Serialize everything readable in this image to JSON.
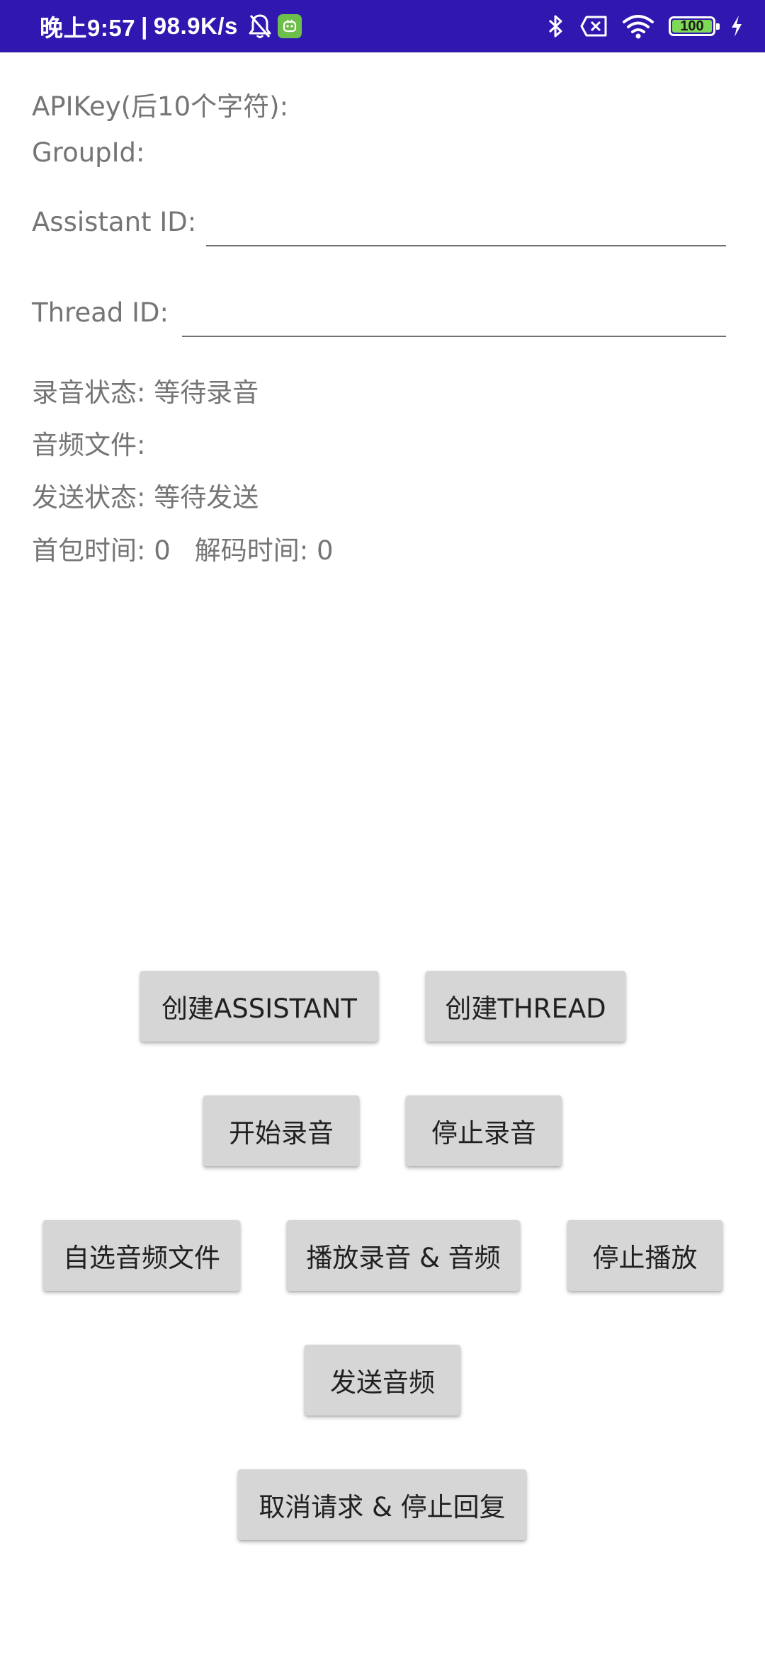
{
  "status_bar": {
    "time": "晚上9:57",
    "separator": "|",
    "net_speed": "98.9K/s",
    "battery_level": "100",
    "icons": [
      "bell-muted-icon",
      "app-notification-icon",
      "bluetooth-icon",
      "sim-off-icon",
      "wifi-icon",
      "battery-icon",
      "charging-bolt-icon"
    ],
    "colors": {
      "background": "#3017b0",
      "text": "#ffffff",
      "battery_fill": "#7ed957"
    }
  },
  "info": {
    "apikey_label": "APIKey(后10个字符):",
    "groupid_label": "GroupId:",
    "assistant_id_label": "Assistant ID:",
    "assistant_id_value": "",
    "thread_id_label": "Thread ID:",
    "thread_id_value": "",
    "record_status": "录音状态: 等待录音",
    "audio_file": "音频文件:",
    "send_status": "发送状态: 等待发送",
    "first_packet_time": "首包时间: 0",
    "decode_time": "解码时间: 0"
  },
  "buttons": {
    "create_assistant": "创建ASSISTANT",
    "create_thread": "创建THREAD",
    "start_recording": "开始录音",
    "stop_recording": "停止录音",
    "choose_audio_file": "自选音频文件",
    "play_recording_audio": "播放录音 & 音频",
    "stop_playback": "停止播放",
    "send_audio": "发送音频",
    "cancel_request_stop_reply": "取消请求 & 停止回复"
  },
  "colors": {
    "button_background": "#d6d6d6",
    "button_text": "#202020",
    "label_text": "#757575",
    "field_underline": "#707070"
  }
}
